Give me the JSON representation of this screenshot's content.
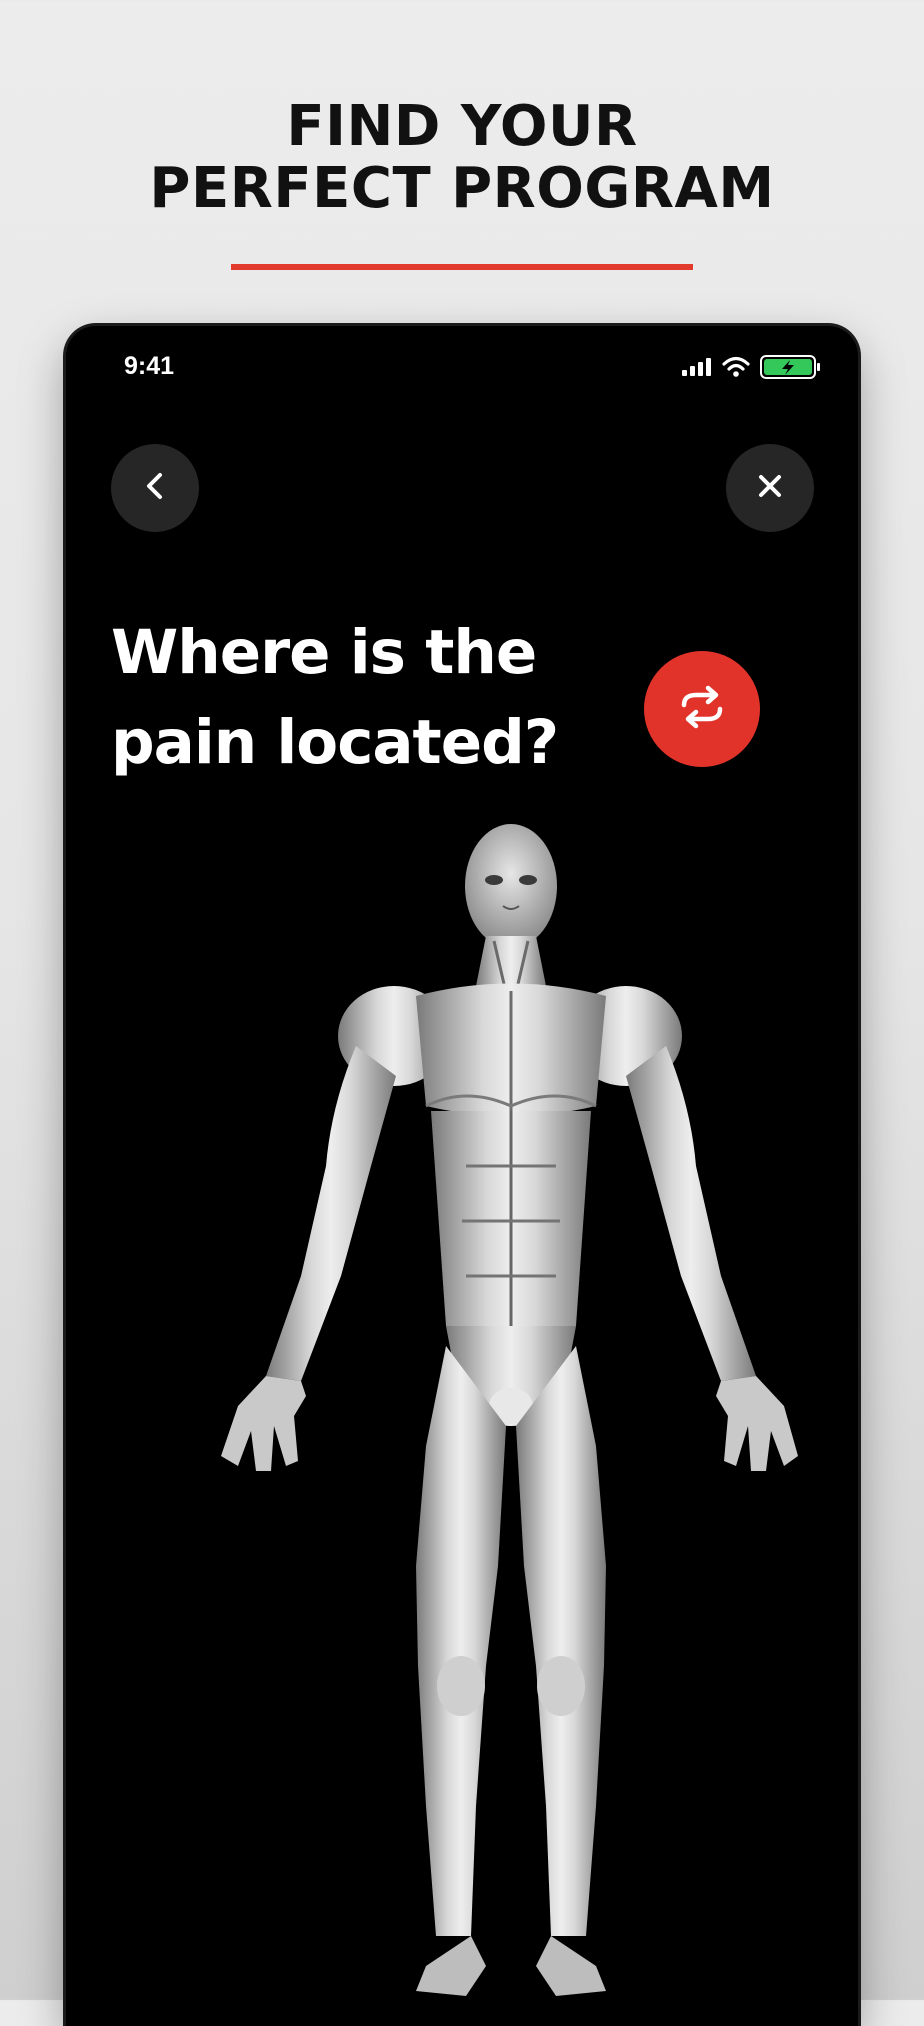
{
  "headline": {
    "line1": "FIND YOUR",
    "line2": "PERFECT PROGRAM"
  },
  "colors": {
    "accent": "#e23a2c",
    "phone_background": "#000000",
    "button_background": "#262626"
  },
  "status_bar": {
    "time": "9:41",
    "icons": [
      "cellular-signal-icon",
      "wifi-icon",
      "battery-charging-icon"
    ]
  },
  "navigation": {
    "back_icon": "chevron-left-icon",
    "close_icon": "close-icon"
  },
  "question": {
    "line1": "Where is the",
    "line2": "pain located?"
  },
  "rotate_button": {
    "icon": "rotate-view-icon"
  },
  "body_map": {
    "view": "front"
  }
}
